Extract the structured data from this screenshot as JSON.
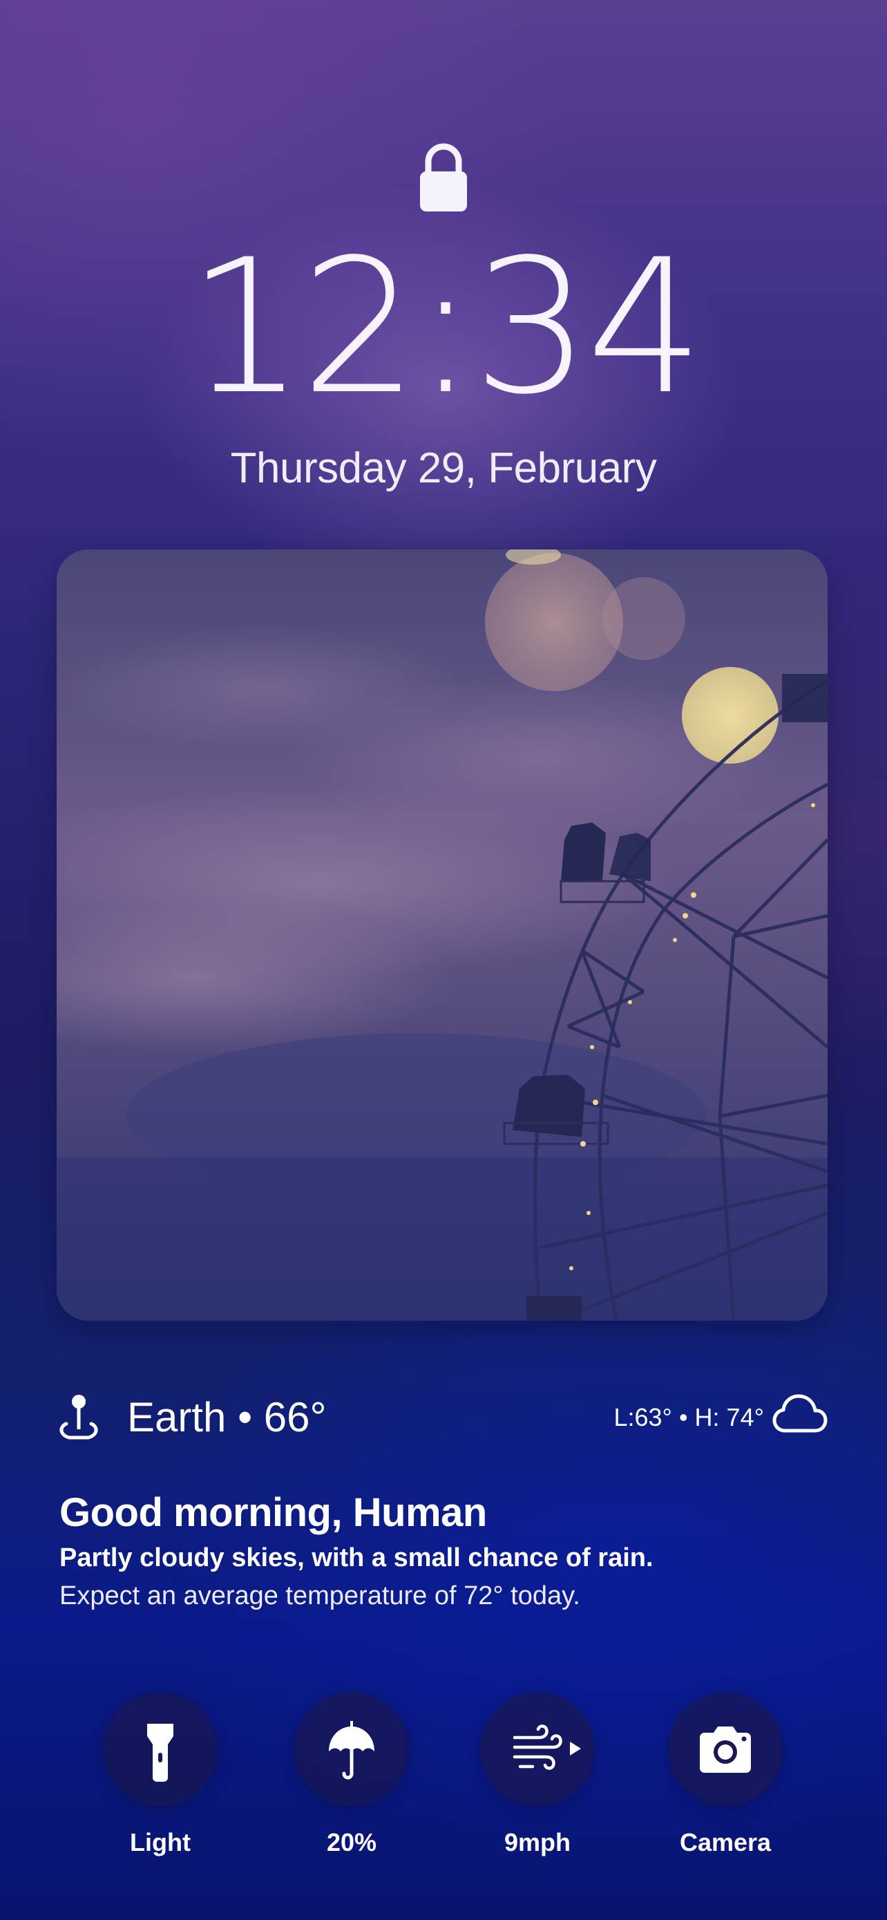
{
  "lockscreen": {
    "time": "12:34",
    "date": "Thursday 29, February"
  },
  "weather": {
    "location": "Earth • 66°",
    "low_high": "L:63° • H: 74°",
    "location_icon": "location-pin-icon",
    "condition_icon": "cloud-icon"
  },
  "greeting": {
    "title": "Good morning, Human",
    "summary": "Partly cloudy skies, with a small chance of rain.",
    "detail": "Expect an average temperature of 72° today."
  },
  "actions": [
    {
      "label": "Light",
      "icon": "flashlight-icon"
    },
    {
      "label": "20%",
      "icon": "umbrella-icon"
    },
    {
      "label": "9mph",
      "icon": "wind-icon"
    },
    {
      "label": "Camera",
      "icon": "camera-icon"
    }
  ],
  "colors": {
    "background_top": "#5a3f93",
    "background_bottom": "#08146e",
    "button_fill": "#19165a"
  }
}
